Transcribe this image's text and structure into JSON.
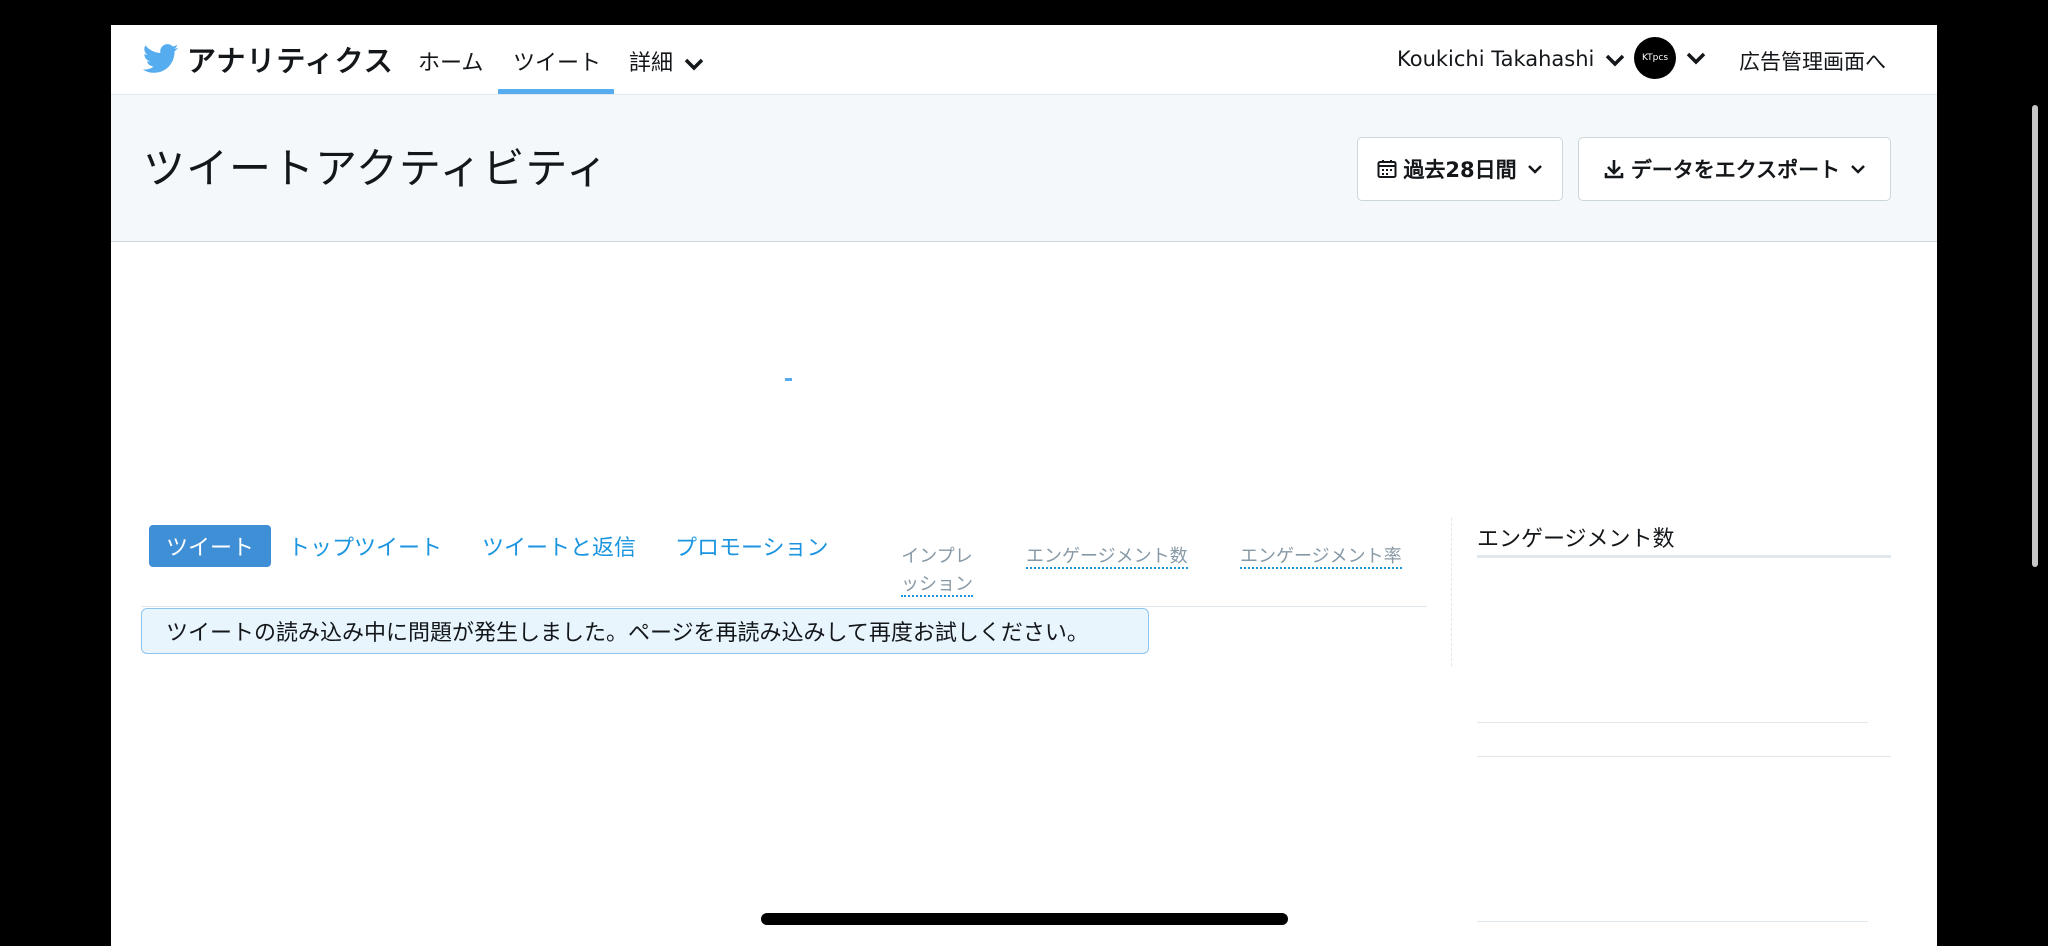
{
  "nav": {
    "brand": "アナリティクス",
    "home": "ホーム",
    "tweets": "ツイート",
    "more": "詳細",
    "user": "Koukichi Takahashi",
    "avatar_text": "KTpcs",
    "ads": "広告管理画面へ"
  },
  "header": {
    "title": "ツイートアクティビティ",
    "date_range": "過去28日間",
    "export": "データをエクスポート"
  },
  "tabs": {
    "tweets": "ツイート",
    "top_tweets": "トップツイート",
    "tweets_replies": "ツイートと返信",
    "promotion": "プロモーション"
  },
  "columns": {
    "impressions_line1": "インプレ",
    "impressions_line2": "ッション",
    "engagements": "エンゲージメント数",
    "engagement_rate": "エンゲージメント率"
  },
  "error": "ツイートの読み込み中に問題が発生しました。ページを再読み込みして再度お試しください。",
  "sidebar": {
    "title": "エンゲージメント数"
  },
  "colors": {
    "twitter_blue": "#55acee",
    "tab_active": "#3f8fd6",
    "link_blue": "#1b95e0"
  }
}
